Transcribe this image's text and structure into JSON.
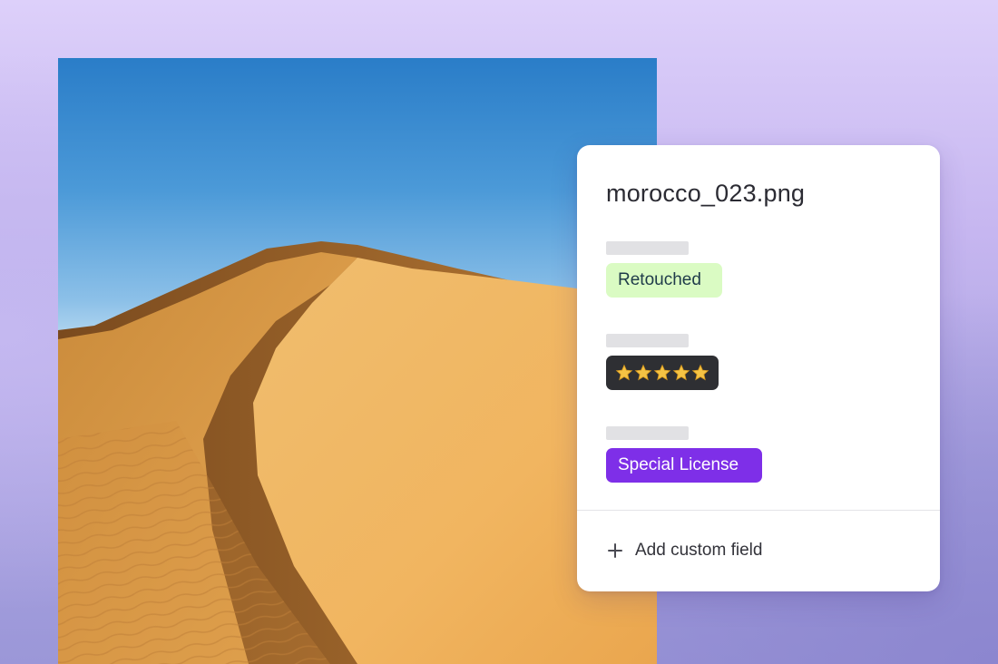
{
  "photo": {
    "subject": "desert-dune-photo"
  },
  "panel": {
    "filename": "morocco_023.png",
    "fields": [
      {
        "value": "Retouched",
        "tag_color": "#dafbc3"
      },
      {
        "value": "★★★★★",
        "rating": 5,
        "max_rating": 5,
        "tag_color": "#2e2f33",
        "star_color": "#f5c344"
      },
      {
        "value": "Special License",
        "tag_color": "#7e2fe8"
      }
    ],
    "add_field_label": "Add custom field",
    "add_field_icon": "plus-icon"
  },
  "colors": {
    "background_top": "#ddd0fa",
    "background_bottom": "#9b97d8",
    "panel": "#ffffff",
    "accent_purple": "#7e2fe8"
  }
}
